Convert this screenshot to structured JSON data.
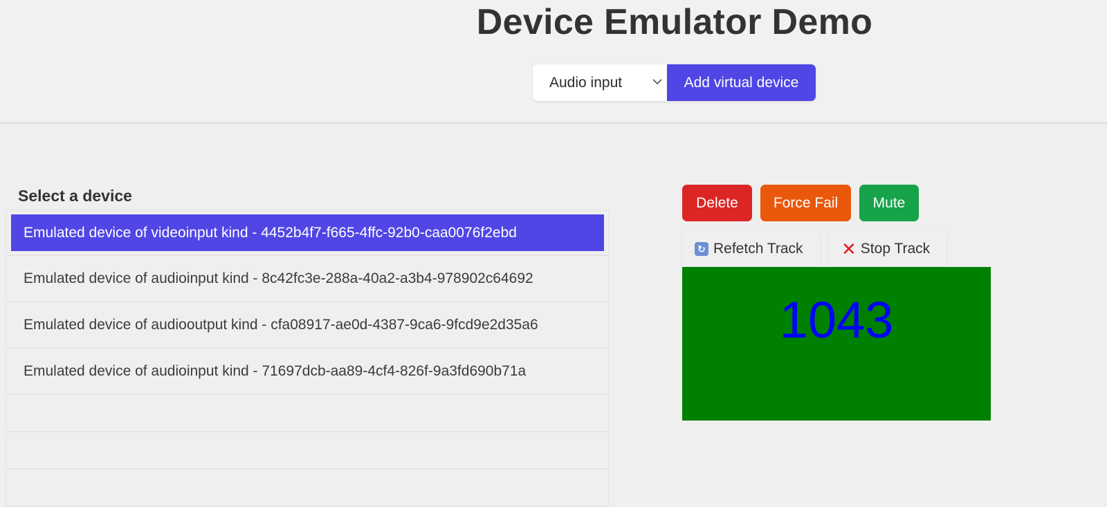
{
  "header": {
    "title": "Device Emulator Demo",
    "device_type_select": {
      "value": "Audio input"
    },
    "add_button_label": "Add virtual device"
  },
  "device_list": {
    "heading": "Select a device",
    "items": [
      {
        "label": "Emulated device of videoinput kind - 4452b4f7-f665-4ffc-92b0-caa0076f2ebd",
        "selected": true
      },
      {
        "label": "Emulated device of audioinput kind - 8c42fc3e-288a-40a2-a3b4-978902c64692",
        "selected": false
      },
      {
        "label": "Emulated device of audiooutput kind - cfa08917-ae0d-4387-9ca6-9fcd9e2d35a6",
        "selected": false
      },
      {
        "label": "Emulated device of audioinput kind - 71697dcb-aa89-4cf4-826f-9a3fd690b71a",
        "selected": false
      }
    ]
  },
  "actions": {
    "delete_label": "Delete",
    "force_fail_label": "Force Fail",
    "mute_label": "Mute"
  },
  "track_actions": {
    "refetch_label": "Refetch Track",
    "refetch_icon": "🔃",
    "stop_label": "Stop Track",
    "stop_icon": "❌"
  },
  "preview": {
    "frame_number": "1043",
    "background_color": "#008000",
    "text_color": "#0000ff"
  },
  "colors": {
    "accent": "#4f46e5",
    "delete": "#dc2626",
    "force_fail": "#ea580c",
    "mute": "#16a34a"
  }
}
